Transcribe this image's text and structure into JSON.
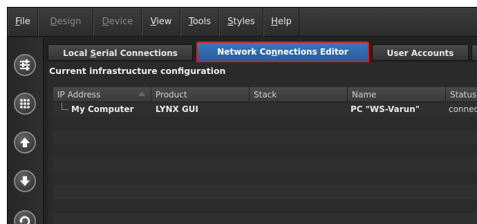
{
  "menubar": {
    "items": [
      {
        "label": "File",
        "u": "F",
        "rest": "ile",
        "disabled": false
      },
      {
        "label": "Design",
        "u": "D",
        "rest": "esign",
        "disabled": true
      },
      {
        "label": "Device",
        "u": "D",
        "rest": "evice",
        "disabled": true
      },
      {
        "label": "View",
        "u": "V",
        "rest": "iew",
        "disabled": false
      },
      {
        "label": "Tools",
        "u": "T",
        "rest": "ools",
        "disabled": false
      },
      {
        "label": "Styles",
        "u": "S",
        "rest": "tyles",
        "disabled": false
      },
      {
        "label": "Help",
        "u": "H",
        "rest": "elp",
        "disabled": false
      }
    ]
  },
  "toolbar": {
    "buttons": [
      "sliders-icon",
      "grid-dots-icon",
      "arrow-up-icon",
      "arrow-down-icon",
      "refresh-icon"
    ]
  },
  "tabs": {
    "local_serial": {
      "pre": "Local ",
      "u": "S",
      "post": "erial Connections"
    },
    "network_editor": {
      "pre": "Network Co",
      "u": "n",
      "post": "nections Editor"
    },
    "user_accounts": {
      "label": "User Accounts"
    }
  },
  "main": {
    "section_title": "Current infrastructure configuration"
  },
  "table": {
    "columns": [
      "IP Address",
      "Product",
      "Stack",
      "Name",
      "Status"
    ],
    "rows": [
      {
        "ip": "My Computer",
        "product": "LYNX GUI",
        "stack": "",
        "name": "PC \"WS-Varun\"",
        "status": "connected"
      }
    ]
  },
  "colors": {
    "active_tab": "#2f68ad",
    "highlight_border": "#e01818",
    "background": "#232323"
  }
}
